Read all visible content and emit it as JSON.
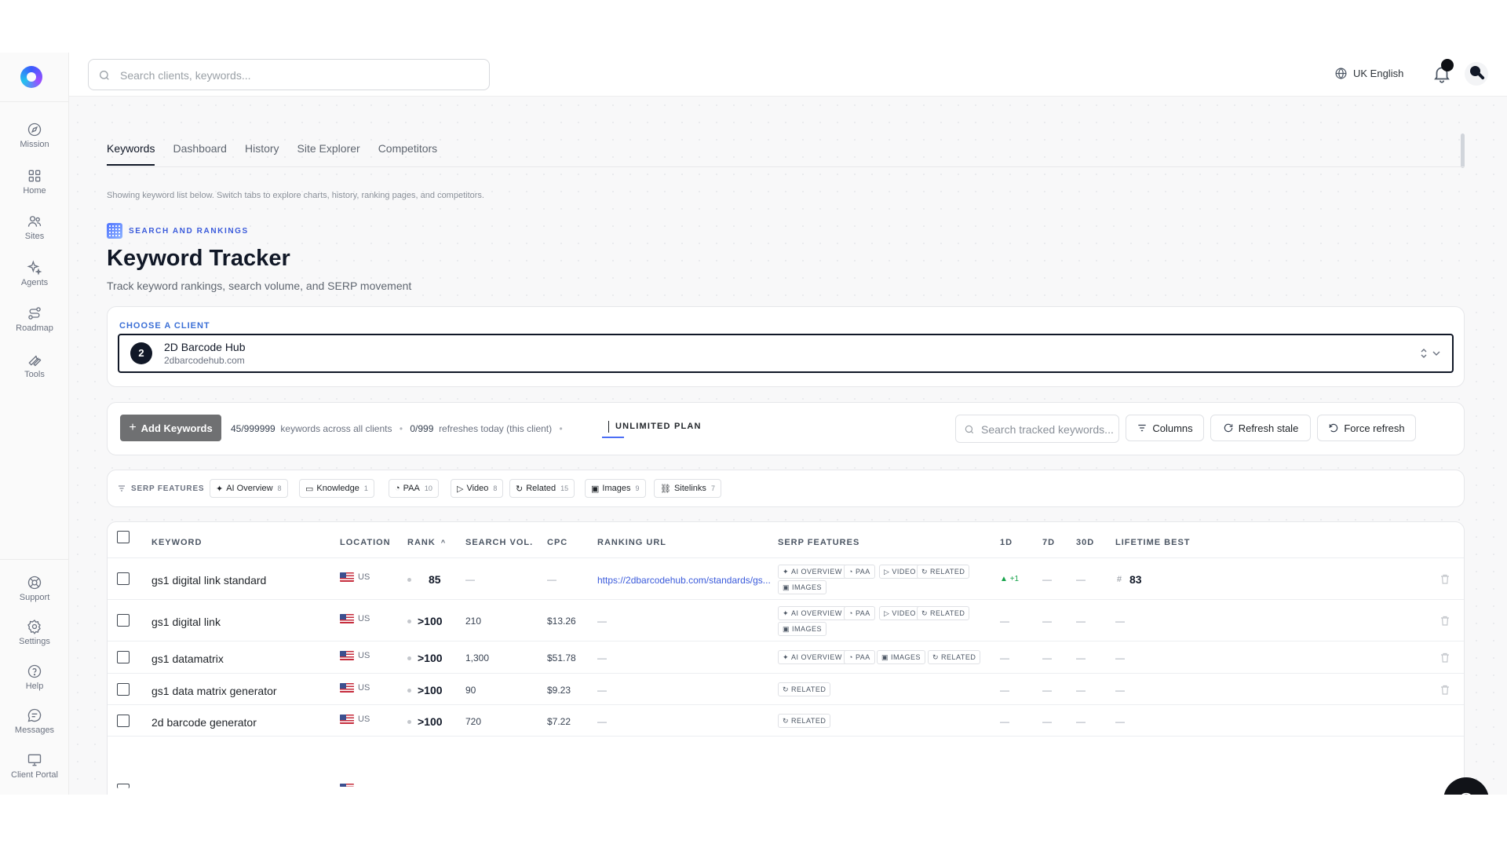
{
  "search": {
    "placeholder": "Search clients, keywords..."
  },
  "topbar": {
    "language": "UK English"
  },
  "sidebar": {
    "items": [
      {
        "label": "Mission",
        "icon": "compass-icon"
      },
      {
        "label": "Home",
        "icon": "grid-icon"
      },
      {
        "label": "Sites",
        "icon": "users-icon"
      },
      {
        "label": "Agents",
        "icon": "sparkles-icon"
      },
      {
        "label": "Roadmap",
        "icon": "route-icon"
      },
      {
        "label": "Tools",
        "icon": "wrench-icon"
      }
    ],
    "bottom": [
      {
        "label": "Support",
        "icon": "lifebuoy-icon"
      },
      {
        "label": "Settings",
        "icon": "gear-icon"
      },
      {
        "label": "Help",
        "icon": "help-circle-icon"
      },
      {
        "label": "Messages",
        "icon": "message-icon"
      },
      {
        "label": "Client Portal",
        "icon": "monitor-icon"
      }
    ]
  },
  "tabs": [
    "Keywords",
    "Dashboard",
    "History",
    "Site Explorer",
    "Competitors"
  ],
  "hint": "Showing keyword list below. Switch tabs to explore charts, history, ranking pages, and competitors.",
  "header": {
    "eyebrow": "SEARCH AND RANKINGS",
    "title": "Keyword Tracker",
    "subtitle": "Track keyword rankings, search volume, and SERP movement"
  },
  "client": {
    "label": "CHOOSE A CLIENT",
    "badge": "2",
    "name": "2D Barcode Hub",
    "domain": "2dbarcodehub.com"
  },
  "actions": {
    "add_label": "Add Keywords",
    "kw_count": "45/999999",
    "kw_text": "keywords across all clients",
    "refresh_count": "0/999",
    "refresh_text": "refreshes today (this client)",
    "plan": "UNLIMITED PLAN",
    "search_placeholder": "Search tracked keywords...",
    "columns": "Columns",
    "refresh_stale": "Refresh stale",
    "force_refresh": "Force refresh"
  },
  "serp_filter": {
    "title": "SERP FEATURES",
    "chips": [
      {
        "label": "AI Overview",
        "count": "8"
      },
      {
        "label": "Knowledge",
        "count": "1"
      },
      {
        "label": "PAA",
        "count": "10"
      },
      {
        "label": "Video",
        "count": "8"
      },
      {
        "label": "Related",
        "count": "15"
      },
      {
        "label": "Images",
        "count": "9"
      },
      {
        "label": "Sitelinks",
        "count": "7"
      }
    ]
  },
  "table": {
    "headers": [
      "KEYWORD",
      "LOCATION",
      "RANK",
      "SEARCH VOL.",
      "CPC",
      "RANKING URL",
      "SERP FEATURES",
      "1D",
      "7D",
      "30D",
      "LIFETIME BEST"
    ],
    "rows": [
      {
        "keyword": "gs1 digital link standard",
        "location": "US",
        "rank": "85",
        "volume": "—",
        "cpc": "—",
        "url": "https://2dbarcodehub.com/standards/gs...",
        "features": [
          "AI OVERVIEW",
          "PAA",
          "VIDEO",
          "RELATED",
          "IMAGES"
        ],
        "d1": "+1",
        "d7": "—",
        "d30": "—",
        "best_hash": "#",
        "best": "83"
      },
      {
        "keyword": "gs1 digital link",
        "location": "US",
        "rank": ">100",
        "volume": "210",
        "cpc": "$13.26",
        "url": "—",
        "features": [
          "AI OVERVIEW",
          "PAA",
          "VIDEO",
          "RELATED",
          "IMAGES"
        ],
        "d1": "—",
        "d7": "—",
        "d30": "—",
        "best": "—"
      },
      {
        "keyword": "gs1 datamatrix",
        "location": "US",
        "rank": ">100",
        "volume": "1,300",
        "cpc": "$51.78",
        "url": "—",
        "features": [
          "AI OVERVIEW",
          "PAA",
          "IMAGES",
          "RELATED"
        ],
        "d1": "—",
        "d7": "—",
        "d30": "—",
        "best": "—"
      },
      {
        "keyword": "gs1 data matrix generator",
        "location": "US",
        "rank": ">100",
        "volume": "90",
        "cpc": "$9.23",
        "url": "—",
        "features": [
          "RELATED"
        ],
        "d1": "—",
        "d7": "—",
        "d30": "—",
        "best": "—"
      },
      {
        "keyword": "2d barcode generator",
        "location": "US",
        "rank": ">100",
        "volume": "720",
        "cpc": "$7.22",
        "url": "—",
        "features": [
          "RELATED"
        ],
        "d1": "—",
        "d7": "—",
        "d30": "—",
        "best": "—"
      }
    ]
  },
  "colors": {
    "accent": "#3b5bdb",
    "positive": "#16a34a",
    "dark": "#111827"
  }
}
